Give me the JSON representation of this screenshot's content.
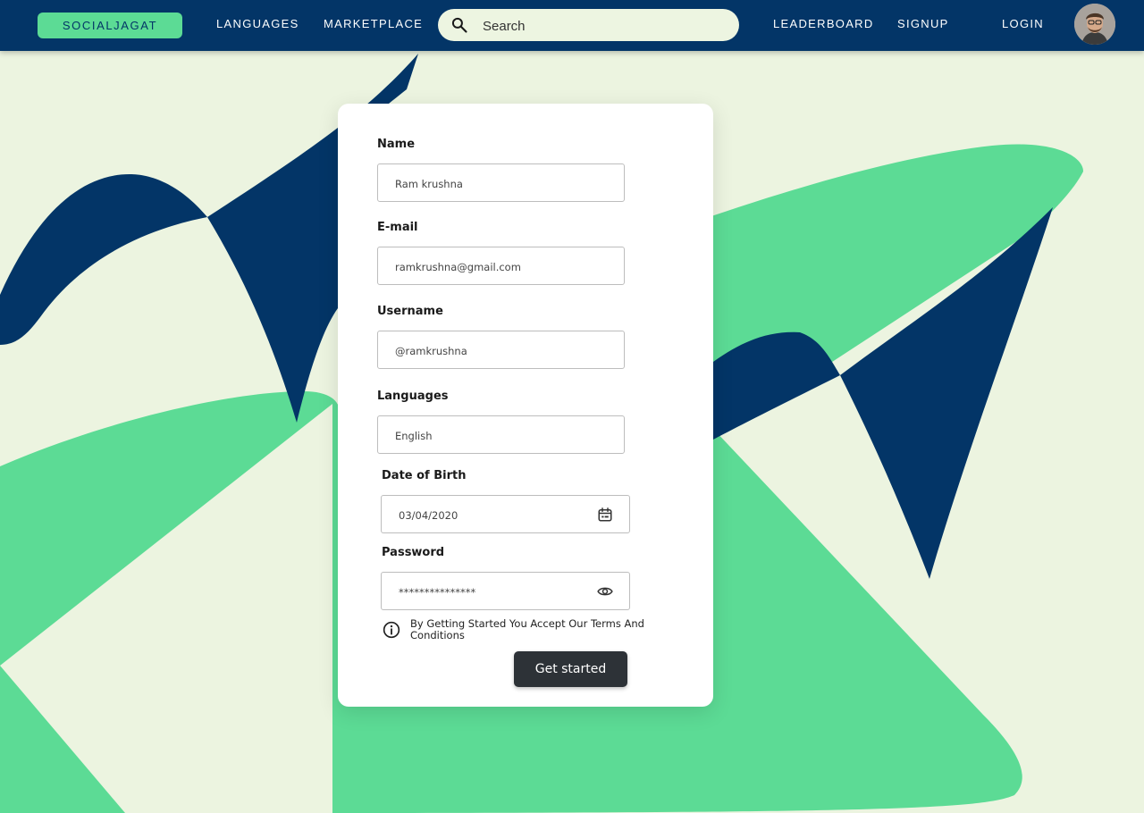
{
  "colors": {
    "navy": "#033567",
    "green": "#5cdb95",
    "background": "#ecf4e0",
    "button": "#2d3237"
  },
  "nav": {
    "brand": "SOCIALJAGAT",
    "links": {
      "languages": "LANGUAGES",
      "marketplace": "MARKETPLACE",
      "leaderboard": "LEADERBOARD",
      "signup": "SIGNUP",
      "login": "LOGIN"
    },
    "search_placeholder": "Search",
    "search_icon": "search-icon",
    "avatar_icon": "user-avatar"
  },
  "form": {
    "name": {
      "label": "Name",
      "value": "Ram krushna"
    },
    "email": {
      "label": "E-mail",
      "value": "ramkrushna@gmail.com"
    },
    "username": {
      "label": "Username",
      "value": "@ramkrushna"
    },
    "languages": {
      "label": "Languages",
      "value": "English"
    },
    "dob": {
      "label": "Date of Birth",
      "value": "03/04/2020",
      "icon": "calendar-icon"
    },
    "password": {
      "label": "Password",
      "value": "***************",
      "icon": "eye-icon"
    },
    "terms": "By Getting Started You Accept Our Terms And Conditions",
    "submit_label": "Get started"
  }
}
